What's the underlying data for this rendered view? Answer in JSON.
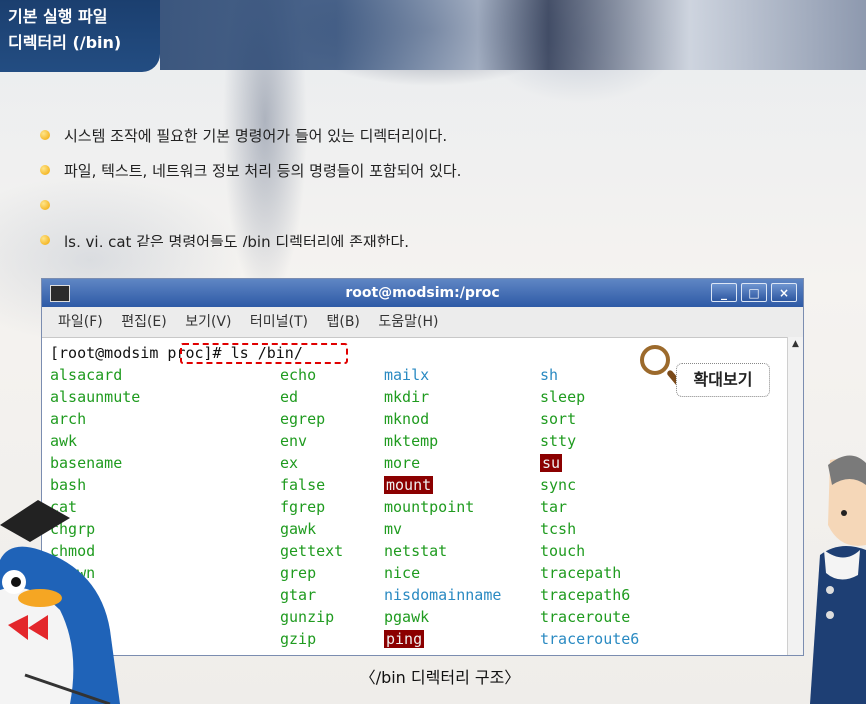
{
  "header": {
    "line1": "기본 실행 파일",
    "line2": "디렉터리 (/bin)"
  },
  "bullets": [
    "시스템 조작에 필요한 기본 명령어가 들어 있는 디렉터리이다.",
    "파일, 텍스트, 네트워크 정보 처리 등의 명령들이 포함되어 있다.",
    "",
    "ls, vi, cat 같은 명령어들도 /bin 디렉터리에 존재한다."
  ],
  "terminal": {
    "title": "root@modsim:/proc",
    "window_buttons": [
      "_",
      "□",
      "×"
    ],
    "menu": [
      "파일(F)",
      "편집(E)",
      "보기(V)",
      "터미널(T)",
      "탭(B)",
      "도움말(H)"
    ],
    "prompt": "[root@modsim proc]# ls /bin/",
    "columns": [
      [
        {
          "t": "alsacard",
          "c": "g"
        },
        {
          "t": "alsaunmute",
          "c": "g"
        },
        {
          "t": "arch",
          "c": "g"
        },
        {
          "t": "awk",
          "c": "g"
        },
        {
          "t": "basename",
          "c": "g"
        },
        {
          "t": "bash",
          "c": "g"
        },
        {
          "t": "cat",
          "c": "g"
        },
        {
          "t": "chgrp",
          "c": "g"
        },
        {
          "t": "chmod",
          "c": "g"
        },
        {
          "t": "chown",
          "c": "g"
        }
      ],
      [
        {
          "t": "echo",
          "c": "g"
        },
        {
          "t": "ed",
          "c": "g"
        },
        {
          "t": "egrep",
          "c": "g"
        },
        {
          "t": "env",
          "c": "g"
        },
        {
          "t": "ex",
          "c": "g"
        },
        {
          "t": "false",
          "c": "g"
        },
        {
          "t": "fgrep",
          "c": "g"
        },
        {
          "t": "gawk",
          "c": "g"
        },
        {
          "t": "gettext",
          "c": "g"
        },
        {
          "t": "grep",
          "c": "g"
        },
        {
          "t": "gtar",
          "c": "g"
        },
        {
          "t": "gunzip",
          "c": "g"
        },
        {
          "t": "gzip",
          "c": "g"
        }
      ],
      [
        {
          "t": "mailx",
          "c": "b"
        },
        {
          "t": "mkdir",
          "c": "g"
        },
        {
          "t": "mknod",
          "c": "g"
        },
        {
          "t": "mktemp",
          "c": "g"
        },
        {
          "t": "more",
          "c": "g"
        },
        {
          "t": "mount",
          "c": "hl"
        },
        {
          "t": "mountpoint",
          "c": "g"
        },
        {
          "t": "mv",
          "c": "g"
        },
        {
          "t": "netstat",
          "c": "g"
        },
        {
          "t": "nice",
          "c": "g"
        },
        {
          "t": "nisdomainname",
          "c": "b"
        },
        {
          "t": "pgawk",
          "c": "g"
        },
        {
          "t": "ping",
          "c": "hl"
        }
      ],
      [
        {
          "t": "sh",
          "c": "b"
        },
        {
          "t": "sleep",
          "c": "g"
        },
        {
          "t": "sort",
          "c": "g"
        },
        {
          "t": "stty",
          "c": "g"
        },
        {
          "t": "su",
          "c": "hl"
        },
        {
          "t": "sync",
          "c": "g"
        },
        {
          "t": "tar",
          "c": "g"
        },
        {
          "t": "tcsh",
          "c": "g"
        },
        {
          "t": "touch",
          "c": "g"
        },
        {
          "t": "tracepath",
          "c": "g"
        },
        {
          "t": "tracepath6",
          "c": "g"
        },
        {
          "t": "traceroute",
          "c": "g"
        },
        {
          "t": "traceroute6",
          "c": "b"
        }
      ]
    ]
  },
  "zoom_label": "확대보기",
  "caption": "〈/bin 디렉터리 구조〉"
}
